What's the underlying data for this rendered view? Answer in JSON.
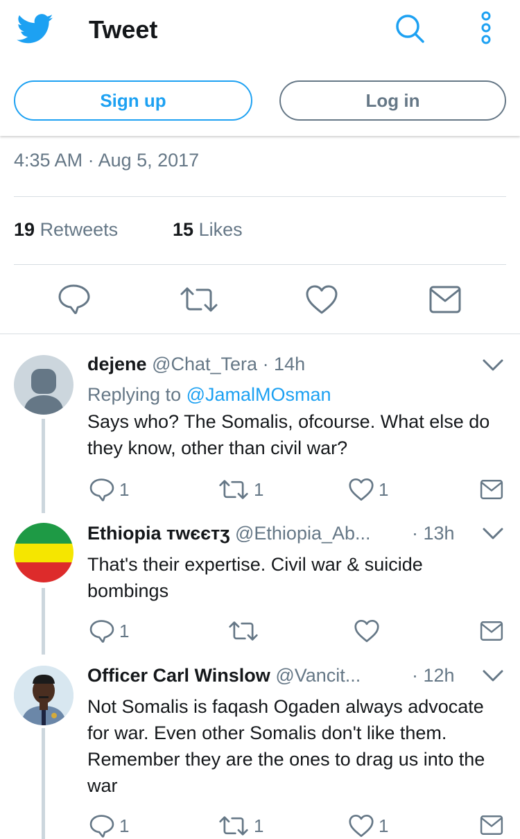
{
  "header": {
    "title": "Tweet",
    "signup_label": "Sign up",
    "login_label": "Log in",
    "icons": [
      "twitter-bird-icon",
      "search-icon",
      "more-icon"
    ]
  },
  "tweet": {
    "timestamp": "4:35 AM · Aug 5, 2017",
    "retweets_count": "19",
    "retweets_label": "Retweets",
    "likes_count": "15",
    "likes_label": "Likes"
  },
  "replies": [
    {
      "name": "dejene",
      "handle": "@Chat_Tera",
      "time": "· 14h",
      "replying_prefix": "Replying to",
      "replying_to": "@JamalMOsman",
      "text": "Says who? The Somalis, ofcourse. What else do they know, other than civil war?",
      "reply_count": "1",
      "retweet_count": "1",
      "like_count": "1"
    },
    {
      "name": "Ethiopia ᴛᴡєєᴛʒ",
      "handle": "@Ethiopia_Ab...",
      "time": "· 13h",
      "text": "That's their expertise. Civil war & suicide bombings",
      "reply_count": "1",
      "retweet_count": "",
      "like_count": ""
    },
    {
      "name": "Officer Carl Winslow",
      "handle": "@Vancit...",
      "time": "· 12h",
      "text": "Not Somalis is faqash Ogaden always advocate for war. Even other Somalis don't like them. Remember they are the ones to drag us into the war",
      "reply_count": "1",
      "retweet_count": "1",
      "like_count": "1"
    }
  ],
  "colors": {
    "brand": "#1da1f2",
    "secondary_text": "#657786",
    "divider": "#d7dde2",
    "thread_line": "#ccd6dd"
  }
}
